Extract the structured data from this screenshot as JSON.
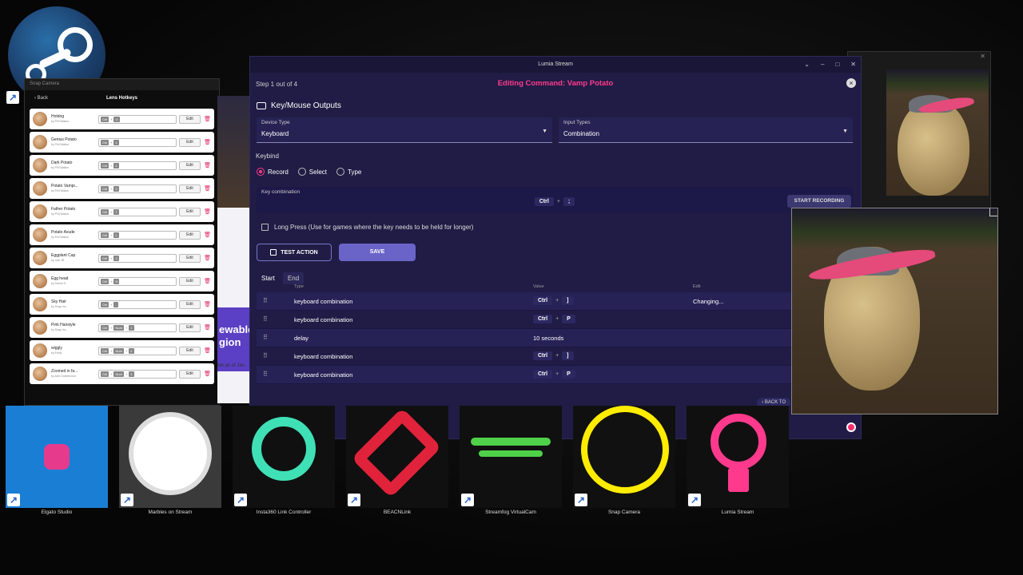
{
  "lumia": {
    "window_title": "Lumia Stream",
    "step": "Step 1 out of 4",
    "editing_title": "Editing Command: Vamp Potato",
    "section_title": "Key/Mouse Outputs",
    "device_type": {
      "label": "Device Type",
      "value": "Keyboard"
    },
    "input_types": {
      "label": "Input Types",
      "value": "Combination"
    },
    "keybind_label": "Keybind",
    "radios": [
      "Record",
      "Select",
      "Type"
    ],
    "key_combination_label": "Key combination",
    "key_combination": [
      "Ctrl",
      ";"
    ],
    "start_recording": "START RECORDING",
    "long_press": "Long Press (Use for games where the key needs to be held for longer)",
    "test_action": "TEST ACTION",
    "save": "SAVE",
    "tabs": [
      "Start",
      "End"
    ],
    "columns": {
      "type": "Type",
      "value": "Value",
      "edit": "Edit"
    },
    "rows": [
      {
        "type": "keyboard combination",
        "keys": [
          "Ctrl",
          "]"
        ],
        "edit": "Changing..."
      },
      {
        "type": "keyboard combination",
        "keys": [
          "Ctrl",
          "P"
        ],
        "edit": ""
      },
      {
        "type": "delay",
        "text": "10 seconds",
        "edit": ""
      },
      {
        "type": "keyboard combination",
        "keys": [
          "Ctrl",
          "]"
        ],
        "edit": ""
      },
      {
        "type": "keyboard combination",
        "keys": [
          "Ctrl",
          "P"
        ],
        "edit": ""
      }
    ],
    "back_to": "BACK TO"
  },
  "snap": {
    "window_title": "Snap Camera",
    "back": "Back",
    "header": "Lens Hotkeys",
    "edit_label": "Edit",
    "lenses": [
      {
        "name": "Hotdog",
        "by": "by Phil Walton",
        "keys": [
          "Ctrl",
          "+",
          "O"
        ]
      },
      {
        "name": "Genius Potato",
        "by": "by Phil Walton",
        "keys": [
          "Ctrl",
          "+",
          "1"
        ]
      },
      {
        "name": "Dark Potato",
        "by": "by Phil Walton",
        "keys": [
          "Ctrl",
          "+",
          "1"
        ]
      },
      {
        "name": "Potato Vampi...",
        "by": "by Phil Walton",
        "keys": [
          "Ctrl",
          "+",
          "2"
        ]
      },
      {
        "name": "Father Potato",
        "by": "by Phil Walton",
        "keys": [
          "Ctrl",
          "+",
          "T"
        ]
      },
      {
        "name": "Potato Avude",
        "by": "by Phil Walton",
        "keys": [
          "Ctrl",
          "+",
          "L"
        ]
      },
      {
        "name": "Eggplant Cap",
        "by": "by Joel JR",
        "keys": [
          "Ctrl",
          "+",
          "C"
        ]
      },
      {
        "name": "Egg head",
        "by": "by Daniel S",
        "keys": [
          "Ctrl",
          "+",
          "H"
        ]
      },
      {
        "name": "Sky Hair",
        "by": "by Snap Inc.",
        "keys": [
          "Ctrl",
          "+",
          "-"
        ]
      },
      {
        "name": "Pink Hairstyle",
        "by": "by Snap Inc.",
        "keys": [
          "Ctrl",
          "+",
          "Num",
          "+",
          "1"
        ]
      },
      {
        "name": "wiggly",
        "by": "by Emily",
        "keys": [
          "Ctrl",
          "+",
          "Num",
          "+",
          "2"
        ]
      },
      {
        "name": "Zoomed in fa...",
        "by": "by Alex Doldrinnoss",
        "keys": [
          "Ctrl",
          "+",
          "Num",
          "+",
          "3"
        ]
      }
    ]
  },
  "browser_fragment": {
    "text_1": "ewable",
    "text_2": "gion",
    "text_3": "ble as of Jan"
  },
  "taskbar": [
    {
      "label": "Elgato Studio",
      "color": "#1a7fd4"
    },
    {
      "label": "Marbles on Stream",
      "color": "#3a3a3a"
    },
    {
      "label": "Insta360 Link Controller",
      "color": "#101010"
    },
    {
      "label": "BEACNLink",
      "color": "#101010"
    },
    {
      "label": "Streamfog VirtualCam",
      "color": "#101010"
    },
    {
      "label": "Snap Camera",
      "color": "#101010"
    },
    {
      "label": "Lumia Stream",
      "color": "#101010"
    }
  ],
  "colors": {
    "accent_pink": "#ff3a8c",
    "lumia_bg": "#201c45",
    "save_button": "#6a64c8"
  }
}
